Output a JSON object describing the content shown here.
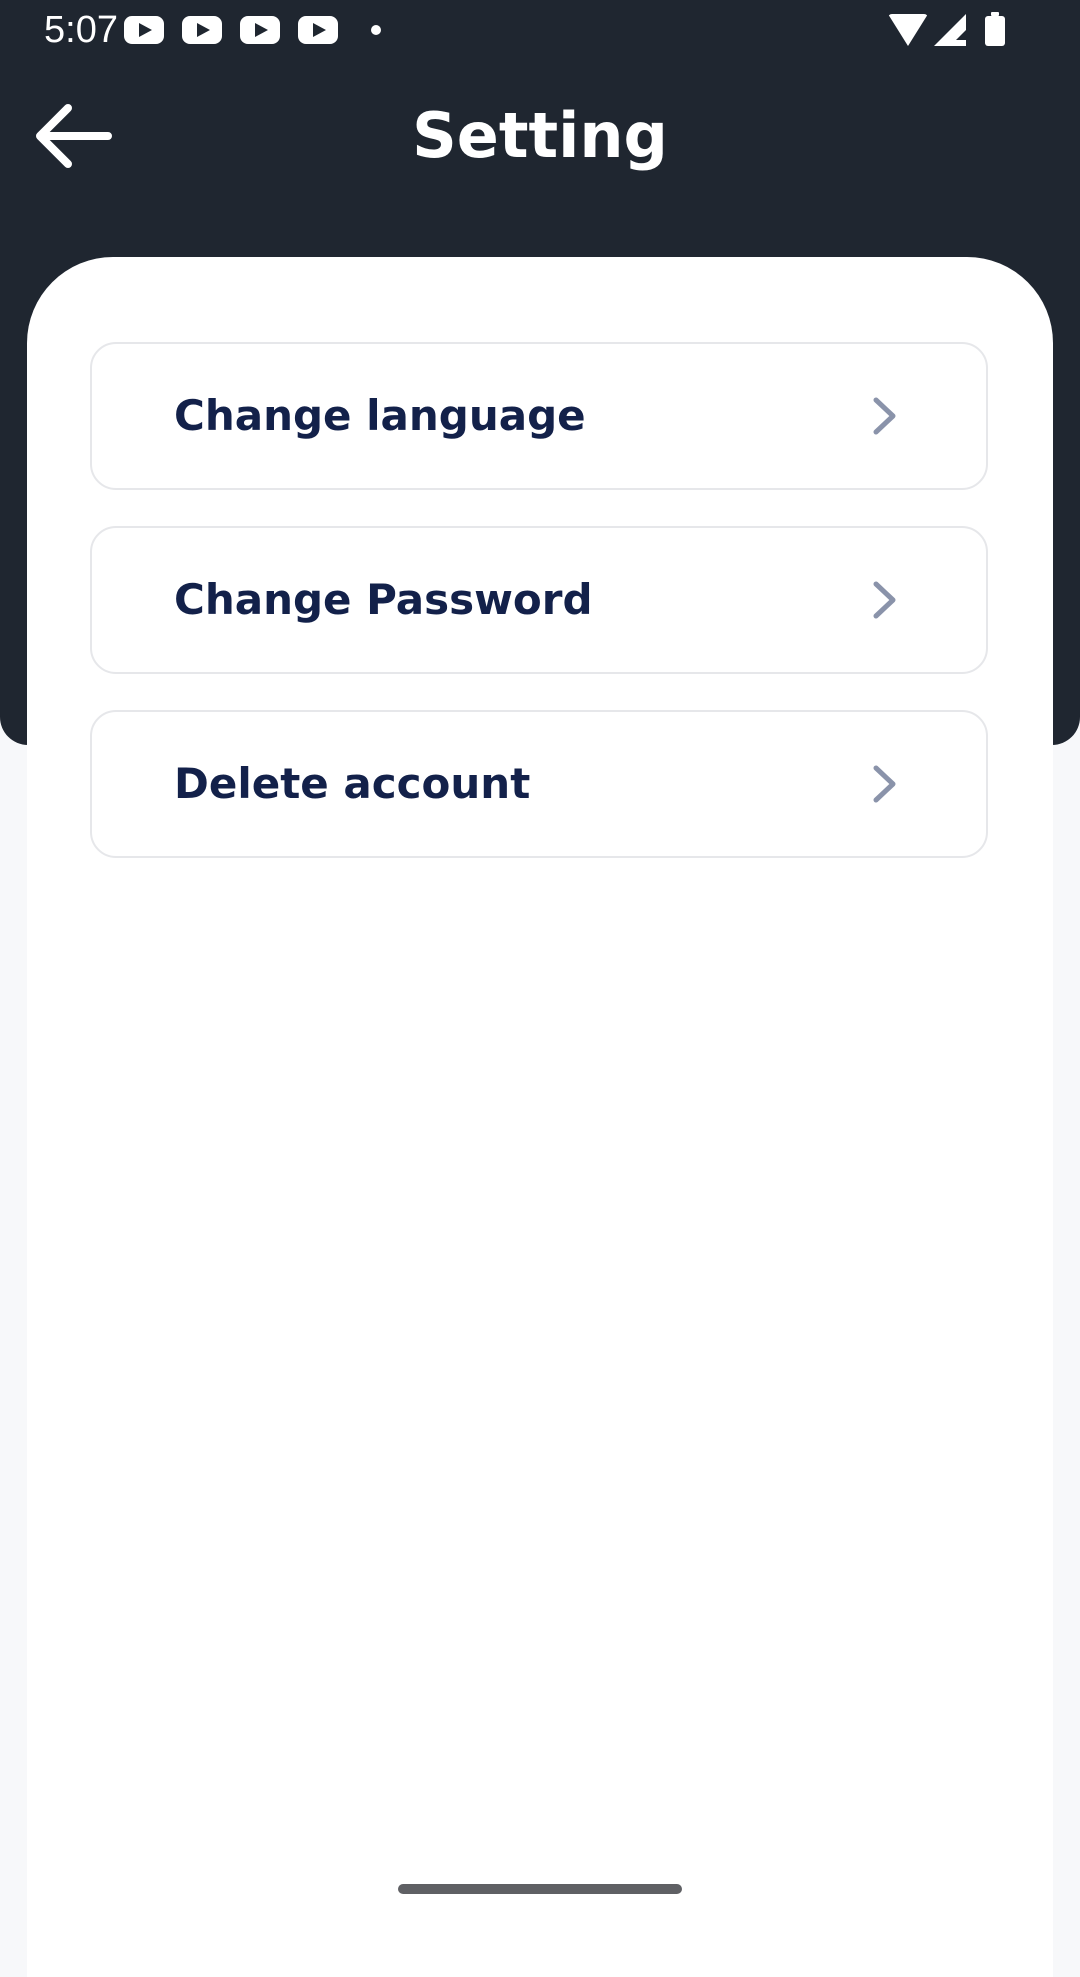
{
  "status_bar": {
    "time": "5:07"
  },
  "header": {
    "title": "Setting",
    "back_icon": "arrow-left-icon"
  },
  "settings": {
    "items": [
      {
        "label": "Change language",
        "icon": "chevron-right-icon"
      },
      {
        "label": "Change Password",
        "icon": "chevron-right-icon"
      },
      {
        "label": "Delete account",
        "icon": "chevron-right-icon"
      }
    ]
  },
  "colors": {
    "header_bg": "#1f2630",
    "label_text": "#13214a",
    "chevron": "#8a93aa",
    "card_border": "#e6e7ea",
    "page_bg": "#f7f8fa"
  }
}
